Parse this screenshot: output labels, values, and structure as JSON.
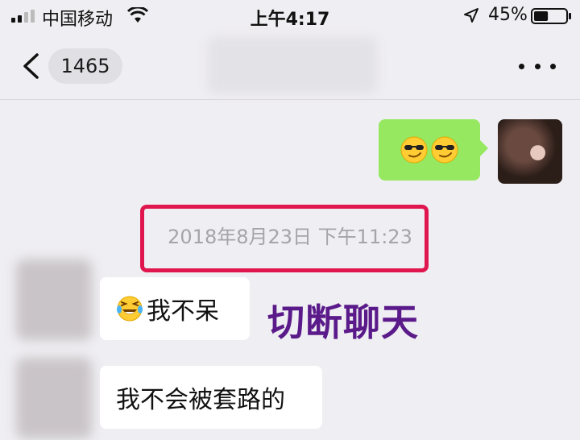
{
  "status_bar": {
    "carrier": "中国移动",
    "time": "上午4:17",
    "battery_percent": "45%",
    "battery_level": 0.45,
    "icons": [
      "signal-icon",
      "wifi-icon",
      "location-arrow-icon",
      "battery-icon"
    ]
  },
  "nav": {
    "unread_count": "1465",
    "icons": [
      "chevron-left-icon",
      "more-icon"
    ]
  },
  "messages": {
    "outgoing_emoji": [
      "smirk-sunglasses-emoji",
      "smirk-sunglasses-emoji"
    ],
    "timestamp": "2018年8月23日 下午11:23",
    "incoming_1_text": "我不呆",
    "incoming_1_emoji": "laughing-tears-emoji",
    "incoming_2_text": "我不会被套路的"
  },
  "annotation": {
    "caption": "切断聊天",
    "caption_color": "#5b1a8a",
    "frame_color": "#e0174f"
  },
  "colors": {
    "outgoing_bubble": "#95e85f",
    "background": "#efeef2"
  }
}
